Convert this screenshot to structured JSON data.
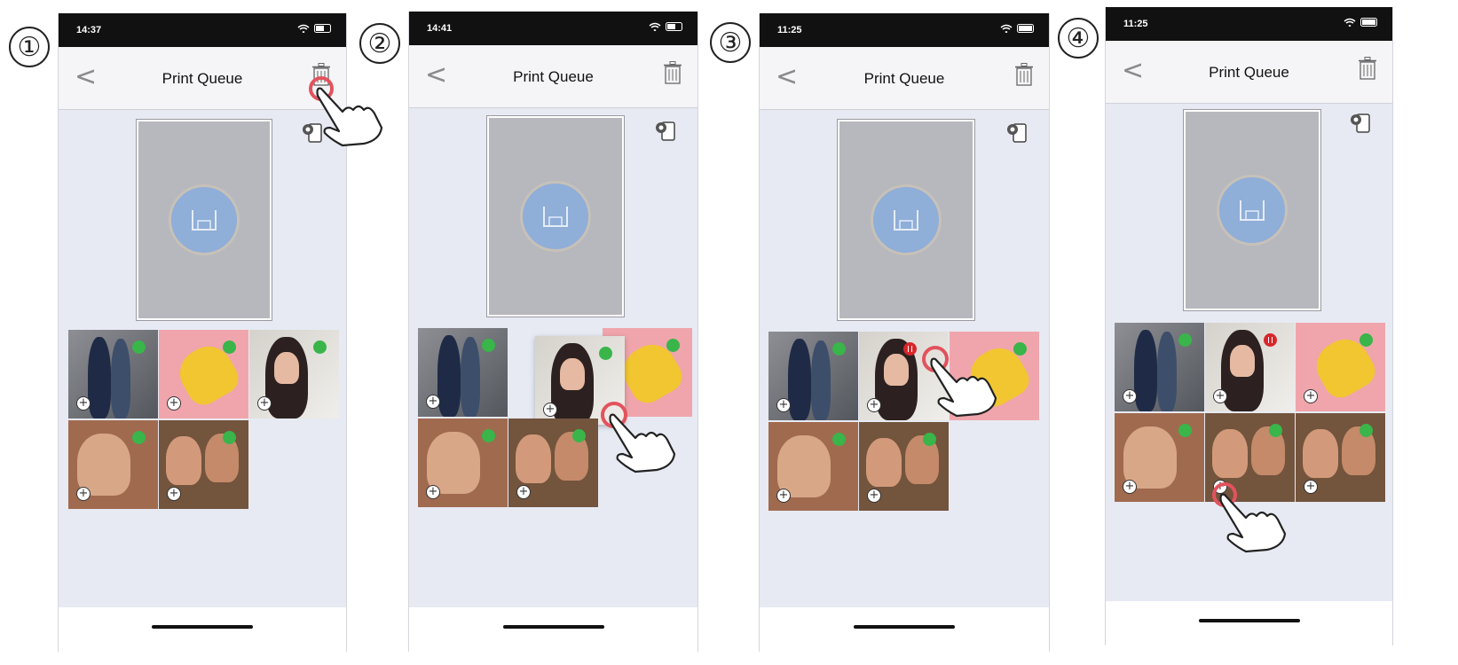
{
  "steps": [
    {
      "number": "①",
      "time": "14:37",
      "title": "Print Queue"
    },
    {
      "number": "②",
      "time": "14:41",
      "title": "Print Queue"
    },
    {
      "number": "③",
      "time": "11:25",
      "title": "Print Queue"
    },
    {
      "number": "④",
      "time": "11:25",
      "title": "Print Queue"
    }
  ],
  "colors": {
    "status_active": "#39b54a",
    "status_paused": "#d8262b",
    "printer_circle": "#8faed8",
    "queue_background": "#e7eaf3"
  },
  "icons": [
    "back-chevron-icon",
    "trash-icon",
    "copies-icon",
    "printer-icon",
    "add-icon",
    "status-dot-icon",
    "pause-icon",
    "tap-hand-icon"
  ],
  "symbols": {
    "back": "<",
    "plus": "+"
  }
}
